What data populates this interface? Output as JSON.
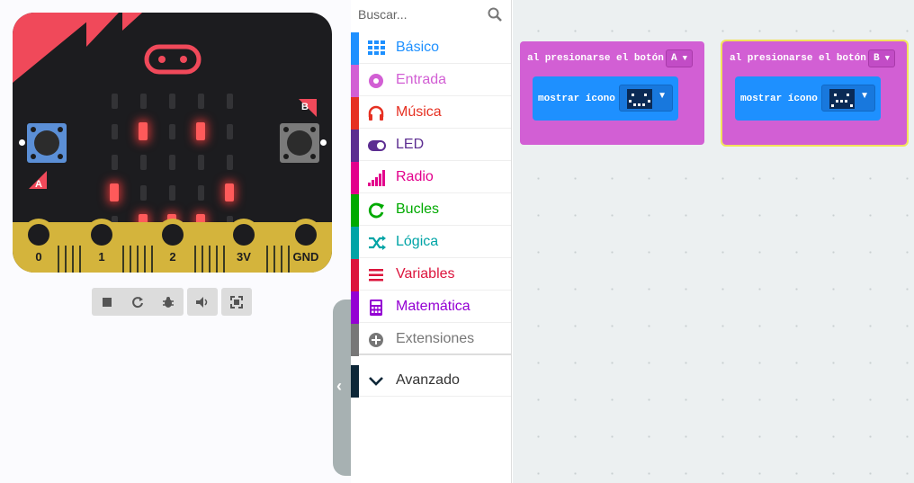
{
  "simulator": {
    "pins": [
      "0",
      "1",
      "2",
      "3V",
      "GND"
    ],
    "button_a": "A",
    "button_b": "B",
    "controls": [
      "stop-icon",
      "restart-icon",
      "debug-icon",
      "sound-icon",
      "fullscreen-icon"
    ]
  },
  "toolbox": {
    "search_placeholder": "Buscar...",
    "categories": [
      {
        "label": "Básico",
        "color": "#1e90ff",
        "icon": "grid-icon"
      },
      {
        "label": "Entrada",
        "color": "#d25fd4",
        "icon": "radio-button-icon"
      },
      {
        "label": "Música",
        "color": "#e63022",
        "icon": "headphones-icon"
      },
      {
        "label": "LED",
        "color": "#5c2d91",
        "icon": "toggle-icon"
      },
      {
        "label": "Radio",
        "color": "#e3008c",
        "icon": "signal-bars-icon"
      },
      {
        "label": "Bucles",
        "color": "#00aa00",
        "icon": "refresh-icon"
      },
      {
        "label": "Lógica",
        "color": "#00a4a6",
        "icon": "shuffle-icon"
      },
      {
        "label": "Variables",
        "color": "#dc143c",
        "icon": "lines-icon"
      },
      {
        "label": "Matemática",
        "color": "#9400d3",
        "icon": "calculator-icon"
      },
      {
        "label": "Extensiones",
        "color": "#777777",
        "icon": "plus-circle-icon"
      },
      {
        "label": "Avanzado",
        "color": "#0c2637",
        "icon": "chevron-down-icon"
      }
    ]
  },
  "workspace": {
    "block_a": {
      "title": "al presionarse el botón",
      "button": "A",
      "inner": "mostrar ícono"
    },
    "block_b": {
      "title": "al presionarse el botón",
      "button": "B",
      "inner": "mostrar ícono"
    }
  }
}
